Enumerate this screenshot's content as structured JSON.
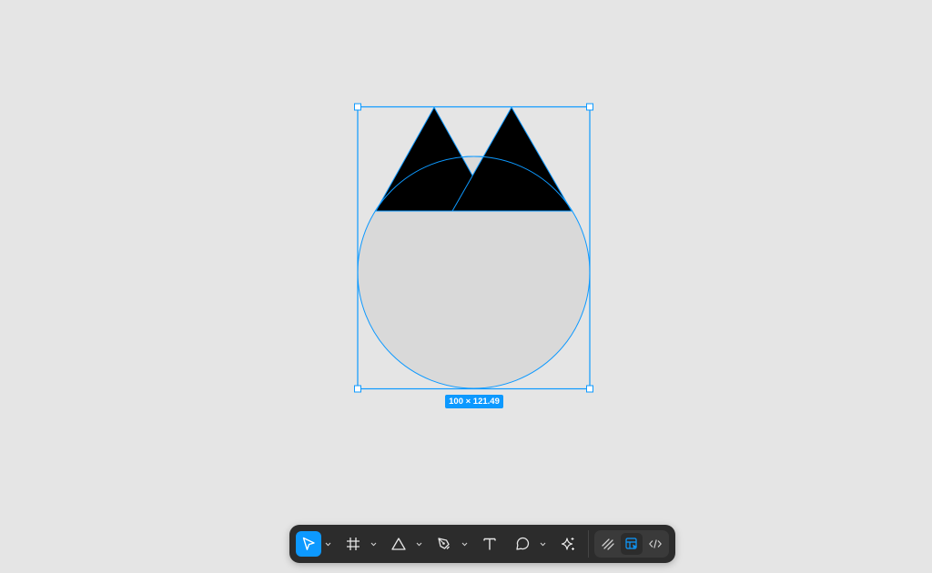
{
  "canvas": {
    "background": "#e5e5e5",
    "selection_color": "#0d99ff"
  },
  "selection": {
    "size_label": "100 × 121.49"
  },
  "shapes": {
    "circle_fill": "#d9d9d9",
    "triangle_fill": "#000000"
  },
  "toolbar": {
    "tools": [
      {
        "name": "move-tool",
        "icon": "cursor-arrow-icon",
        "active": true,
        "has_dropdown": true
      },
      {
        "name": "frame-tool",
        "icon": "frame-hash-icon",
        "active": false,
        "has_dropdown": true
      },
      {
        "name": "shape-tool",
        "icon": "triangle-icon",
        "active": false,
        "has_dropdown": true
      },
      {
        "name": "pen-tool",
        "icon": "pen-nib-icon",
        "active": false,
        "has_dropdown": true
      },
      {
        "name": "text-tool",
        "icon": "text-t-icon",
        "active": false,
        "has_dropdown": false
      },
      {
        "name": "comment-tool",
        "icon": "comment-bubble-icon",
        "active": false,
        "has_dropdown": true
      },
      {
        "name": "actions-tool",
        "icon": "sparkle-icon",
        "active": false,
        "has_dropdown": false
      }
    ],
    "modes": [
      {
        "name": "draw-mode",
        "icon": "draw-brush-icon",
        "active": false
      },
      {
        "name": "design-mode",
        "icon": "design-layout-icon",
        "active": true
      },
      {
        "name": "dev-mode",
        "icon": "code-brackets-icon",
        "active": false
      }
    ]
  }
}
